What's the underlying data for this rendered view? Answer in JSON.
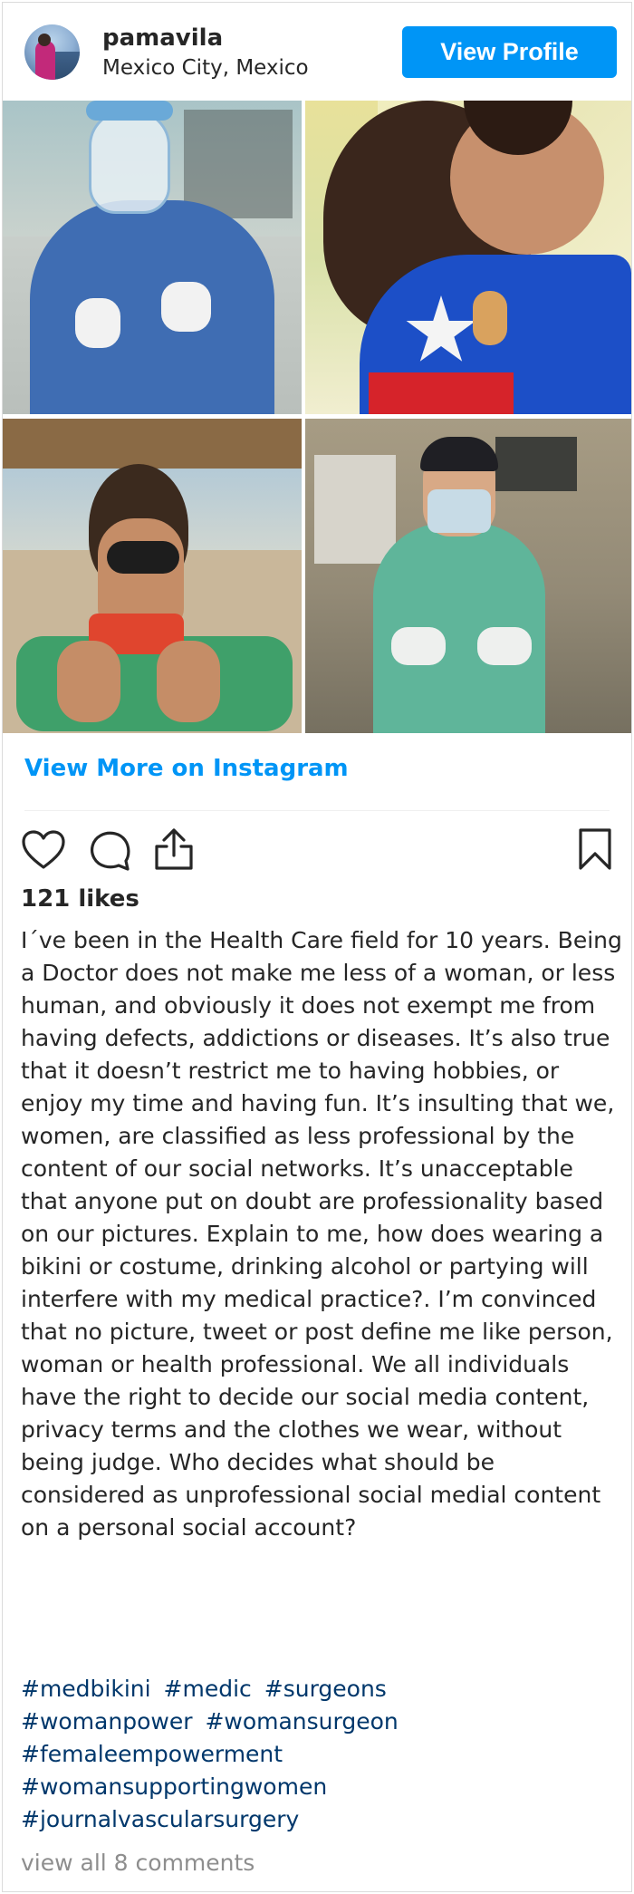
{
  "header": {
    "username": "pamavila",
    "location": "Mexico City, Mexico",
    "view_profile_label": "View Profile"
  },
  "photos": [
    {
      "label": "post-photo-1"
    },
    {
      "label": "post-photo-2"
    },
    {
      "label": "post-photo-3"
    },
    {
      "label": "post-photo-4"
    }
  ],
  "view_more_label": "View More on Instagram",
  "actions": {
    "like_icon": "heart-icon",
    "comment_icon": "comment-icon",
    "share_icon": "share-icon",
    "save_icon": "bookmark-icon"
  },
  "likes_label": "121 likes",
  "caption": "I´ve been in the Health Care field for 10 years. Being a Doctor does not make me less of a woman, or less human, and obviously it does not exempt me from having defects, addictions or diseases. It’s also true that it doesn’t restrict me to having hobbies, or enjoy my time and having fun. It’s insulting that we, women, are classified as less professional by the content of our social networks. It’s unacceptable that anyone put on doubt are professionality based on our pictures. Explain to me, how does wearing a bikini or costume, drinking alcohol or partying will interfere with my medical practice?. I’m convinced that no picture, tweet or post define me like person, woman or health professional. We all individuals have the right to decide our social media content, privacy terms and the clothes we wear, without being judge. Who decides what should be considered as unprofessional social medial content on a personal social account?",
  "hashtags": [
    "#medbikini",
    "#medic",
    "#surgeons",
    "#womanpower",
    "#womansurgeon",
    "#femaleempowerment",
    "#womansupportingwomen",
    "#journalvascularsurgery"
  ],
  "comments_label": "view all 8 comments",
  "colors": {
    "accent": "#0095f6",
    "hashtag": "#00376b",
    "muted": "#8e8e8e",
    "text": "#262626"
  }
}
